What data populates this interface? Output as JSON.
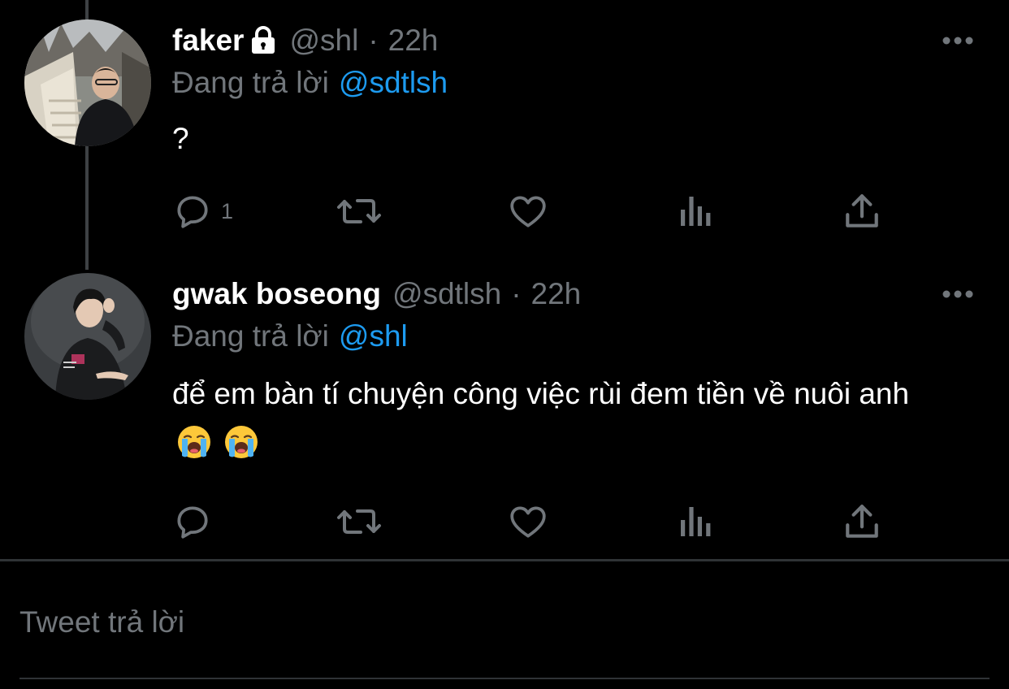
{
  "colors": {
    "background": "#000000",
    "text_primary": "#ffffff",
    "text_secondary": "#71767b",
    "accent_link": "#1d9bf0",
    "divider": "#2f3336",
    "thread_line": "#3e4144"
  },
  "tweets": [
    {
      "display_name": "faker",
      "protected_icon": "lock-icon",
      "handle": "@shl",
      "separator": "·",
      "time": "22h",
      "reply_prefix": "Đang trả lời",
      "reply_to": "@sdtlsh",
      "text": "?",
      "emojis": [],
      "actions": {
        "reply_icon": "comment-icon",
        "reply_count": "1",
        "retweet_icon": "retweet-icon",
        "like_icon": "heart-icon",
        "analytics_icon": "analytics-icon",
        "share_icon": "share-icon"
      },
      "more_icon": "more-dots-icon"
    },
    {
      "display_name": "gwak boseong",
      "handle": "@sdtlsh",
      "separator": "·",
      "time": "22h",
      "reply_prefix": "Đang trả lời",
      "reply_to": "@shl",
      "text": "để em bàn tí chuyện công việc rùi đem tiền về nuôi anh",
      "emojis": [
        "loudly-crying-face-emoji",
        "loudly-crying-face-emoji"
      ],
      "actions": {
        "reply_icon": "comment-icon",
        "reply_count": "",
        "retweet_icon": "retweet-icon",
        "like_icon": "heart-icon",
        "analytics_icon": "analytics-icon",
        "share_icon": "share-icon"
      },
      "more_icon": "more-dots-icon"
    }
  ],
  "compose": {
    "placeholder": "Tweet trả lời"
  }
}
